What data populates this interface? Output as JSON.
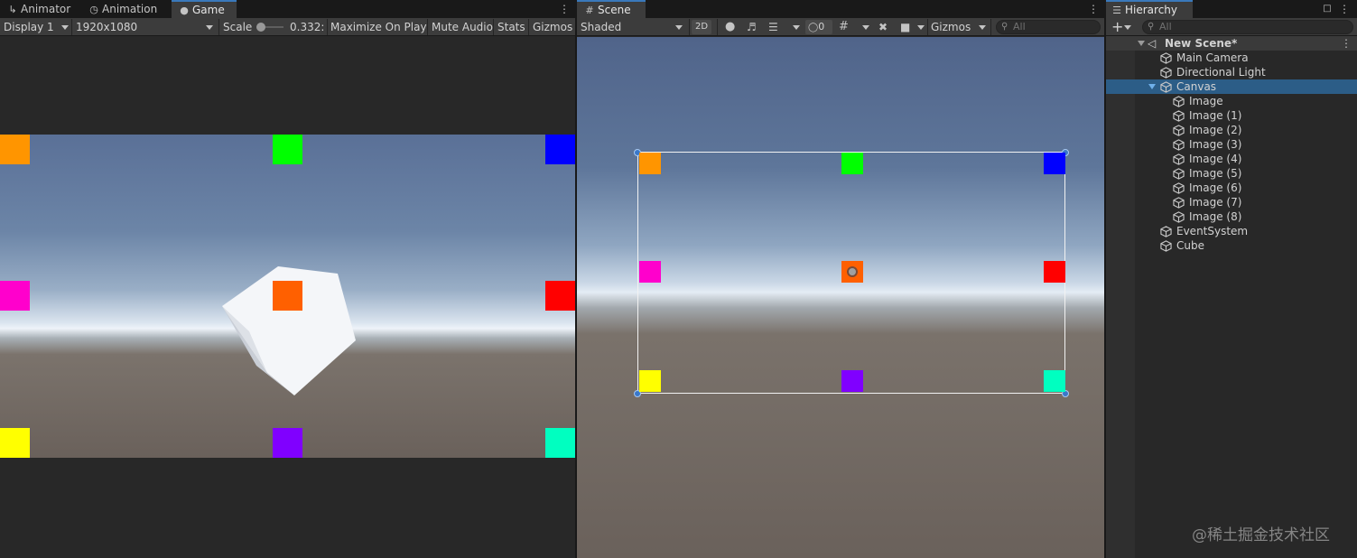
{
  "game_panel": {
    "tabs": [
      {
        "label": "Animator",
        "icon": "animator-icon"
      },
      {
        "label": "Animation",
        "icon": "animation-clock-icon"
      },
      {
        "label": "Game",
        "icon": "gamepad-icon",
        "active": true
      }
    ],
    "toolbar": {
      "display": "Display 1",
      "resolution": "1920x1080",
      "scale_label": "Scale",
      "scale_value": "0.332:",
      "maximize": "Maximize On Play",
      "mute": "Mute Audio",
      "stats": "Stats",
      "gizmos": "Gizmos"
    },
    "colors": {
      "sky_top": "#5b7298",
      "horizon": "#e9eef5",
      "ground": "#6a615b",
      "letterbox": "#282828"
    }
  },
  "scene_panel": {
    "tab": {
      "label": "Scene",
      "icon": "grid-icon"
    },
    "toolbar": {
      "shading": "Shaded",
      "mode_2d": "2D",
      "hidden_count": "0",
      "gizmos": "Gizmos",
      "search_placeholder": "All"
    }
  },
  "hierarchy": {
    "tab": {
      "label": "Hierarchy",
      "icon": "list-icon"
    },
    "search_placeholder": "All",
    "scene_name": "New Scene*",
    "items": [
      {
        "label": "Main Camera",
        "depth": 1
      },
      {
        "label": "Directional Light",
        "depth": 1
      },
      {
        "label": "Canvas",
        "depth": 1,
        "selected": true,
        "expanded": true
      },
      {
        "label": "Image",
        "depth": 2
      },
      {
        "label": "Image (1)",
        "depth": 2
      },
      {
        "label": "Image (2)",
        "depth": 2
      },
      {
        "label": "Image (3)",
        "depth": 2
      },
      {
        "label": "Image (4)",
        "depth": 2
      },
      {
        "label": "Image (5)",
        "depth": 2
      },
      {
        "label": "Image (6)",
        "depth": 2
      },
      {
        "label": "Image (7)",
        "depth": 2
      },
      {
        "label": "Image (8)",
        "depth": 2
      },
      {
        "label": "EventSystem",
        "depth": 1
      },
      {
        "label": "Cube",
        "depth": 1
      }
    ],
    "selection_color": "#2c5d87"
  },
  "ui_images": {
    "colors": {
      "top_left": "#ff9500",
      "top_center": "#00ff00",
      "top_right": "#0000ff",
      "middle_left": "#ff00cc",
      "middle_center": "#ff6000",
      "middle_right": "#ff0000",
      "bottom_left": "#ffff00",
      "bottom_center": "#8000ff",
      "bottom_right": "#00ffc0"
    }
  },
  "watermark": "@稀土掘金技术社区"
}
